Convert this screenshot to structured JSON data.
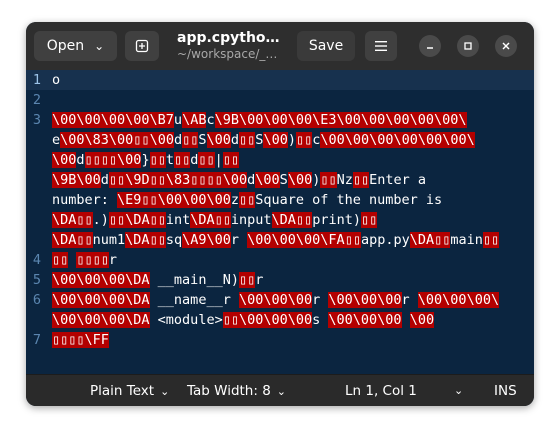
{
  "header": {
    "open_label": "Open",
    "title": "app.cpytho…",
    "subtitle": "~/workspace/_…",
    "save_label": "Save"
  },
  "icons": {
    "open_chevron": "chevron-down-icon",
    "new_tab": "new-tab-icon",
    "menu": "hamburger-menu-icon",
    "minimize": "minimize-icon",
    "maximize": "maximize-icon",
    "close": "close-icon"
  },
  "editor": {
    "line_numbers": [
      "1",
      "2",
      "3",
      "4",
      "5",
      "6",
      "7"
    ],
    "visual_lines": [
      [
        [
          "o",
          false
        ]
      ],
      [],
      [
        [
          "\\00\\00\\00\\00\\B7",
          true
        ],
        [
          "u",
          false
        ],
        [
          "\\AB",
          true
        ],
        [
          "c",
          false
        ],
        [
          "\\9B\\00\\00\\00\\E3\\00\\00\\00\\00\\00\\",
          true
        ]
      ],
      [
        [
          "e",
          false
        ],
        [
          "\\00\\83\\00",
          true
        ],
        [
          "▯▯",
          true
        ],
        [
          "\\00",
          true
        ],
        [
          "d",
          false
        ],
        [
          "▯▯",
          true
        ],
        [
          "S",
          false
        ],
        [
          "\\00",
          true
        ],
        [
          "d",
          false
        ],
        [
          "▯▯",
          true
        ],
        [
          "S",
          false
        ],
        [
          "\\00",
          true
        ],
        [
          ")",
          false
        ],
        [
          "▯▯",
          true
        ],
        [
          "c",
          false
        ],
        [
          "\\00\\00\\00\\00\\00\\00\\",
          true
        ]
      ],
      [
        [
          "\\00",
          true
        ],
        [
          "d",
          false
        ],
        [
          "▯▯▯▯",
          true
        ],
        [
          "\\00",
          true
        ],
        [
          "}",
          false
        ],
        [
          "▯▯",
          true
        ],
        [
          "t",
          false
        ],
        [
          "▯▯",
          true
        ],
        [
          "d",
          false
        ],
        [
          "▯▯",
          true
        ],
        [
          "|",
          false
        ],
        [
          "▯▯",
          true
        ]
      ],
      [
        [
          "\\9B\\00",
          true
        ],
        [
          "d",
          false
        ],
        [
          "▯▯",
          true
        ],
        [
          "\\9D",
          true
        ],
        [
          "▯▯",
          true
        ],
        [
          "\\83",
          true
        ],
        [
          "▯▯▯▯",
          true
        ],
        [
          "\\00",
          true
        ],
        [
          "d",
          false
        ],
        [
          "\\00",
          true
        ],
        [
          "S",
          false
        ],
        [
          "\\00",
          true
        ],
        [
          ")",
          false
        ],
        [
          "▯▯",
          true
        ],
        [
          "Nz",
          false
        ],
        [
          "▯▯",
          true
        ],
        [
          "Enter a",
          false
        ]
      ],
      [
        [
          "number: ",
          false
        ],
        [
          "\\E9",
          true
        ],
        [
          "▯▯",
          true
        ],
        [
          "\\00\\00\\00",
          true
        ],
        [
          "z",
          false
        ],
        [
          "▯▯",
          true
        ],
        [
          "Square of the number is",
          false
        ]
      ],
      [
        [
          "\\DA",
          true
        ],
        [
          "▯▯",
          true
        ],
        [
          ".)",
          false
        ],
        [
          "▯▯",
          true
        ],
        [
          "\\DA",
          true
        ],
        [
          "▯▯",
          true
        ],
        [
          "int",
          false
        ],
        [
          "\\DA",
          true
        ],
        [
          "▯▯",
          true
        ],
        [
          "input",
          false
        ],
        [
          "\\DA",
          true
        ],
        [
          "▯▯",
          true
        ],
        [
          "print)",
          false
        ],
        [
          "▯▯",
          true
        ]
      ],
      [
        [
          "\\DA",
          true
        ],
        [
          "▯▯",
          true
        ],
        [
          "num1",
          false
        ],
        [
          "\\DA",
          true
        ],
        [
          "▯▯",
          true
        ],
        [
          "sq",
          false
        ],
        [
          "\\A9\\00",
          true
        ],
        [
          "r ",
          false
        ],
        [
          "\\00\\00\\00\\FA",
          true
        ],
        [
          "▯▯",
          true
        ],
        [
          "app.py",
          false
        ],
        [
          "\\DA",
          true
        ],
        [
          "▯▯",
          true
        ],
        [
          "main",
          false
        ],
        [
          "▯▯",
          true
        ]
      ],
      [
        [
          "▯▯",
          true
        ],
        [
          " ",
          false
        ],
        [
          "▯▯▯▯",
          true
        ],
        [
          "r",
          false
        ]
      ],
      [
        [
          "\\00\\00\\00\\DA",
          true
        ],
        [
          " __main__N)",
          false
        ],
        [
          "▯▯",
          true
        ],
        [
          "r",
          false
        ]
      ],
      [
        [
          "\\00\\00\\00\\DA",
          true
        ],
        [
          " __name__r ",
          false
        ],
        [
          "\\00\\00\\00",
          true
        ],
        [
          "r ",
          false
        ],
        [
          "\\00\\00\\00",
          true
        ],
        [
          "r ",
          false
        ],
        [
          "\\00\\00\\00\\",
          true
        ]
      ],
      [
        [
          "\\00\\00\\00\\DA",
          true
        ],
        [
          " <module>",
          false
        ],
        [
          "▯▯",
          true
        ],
        [
          "\\00\\00\\00",
          true
        ],
        [
          "s ",
          false
        ],
        [
          "\\00\\00\\00",
          true
        ],
        [
          " ",
          false
        ],
        [
          "\\00",
          true
        ]
      ],
      [
        [
          "▯▯",
          true
        ],
        [
          "▯▯",
          true
        ],
        [
          "\\FF",
          true
        ]
      ]
    ]
  },
  "status": {
    "language": "Plain Text",
    "tab_width": "Tab Width: 8",
    "position": "Ln 1, Col 1",
    "mode": "INS"
  },
  "colors": {
    "editor_bg": "#0b2540",
    "current_line_bg": "#17314e",
    "escape_highlight": "#b30000",
    "headerbar_bg": "#2e2e2e",
    "statusbar_bg": "#2a2a2a"
  }
}
